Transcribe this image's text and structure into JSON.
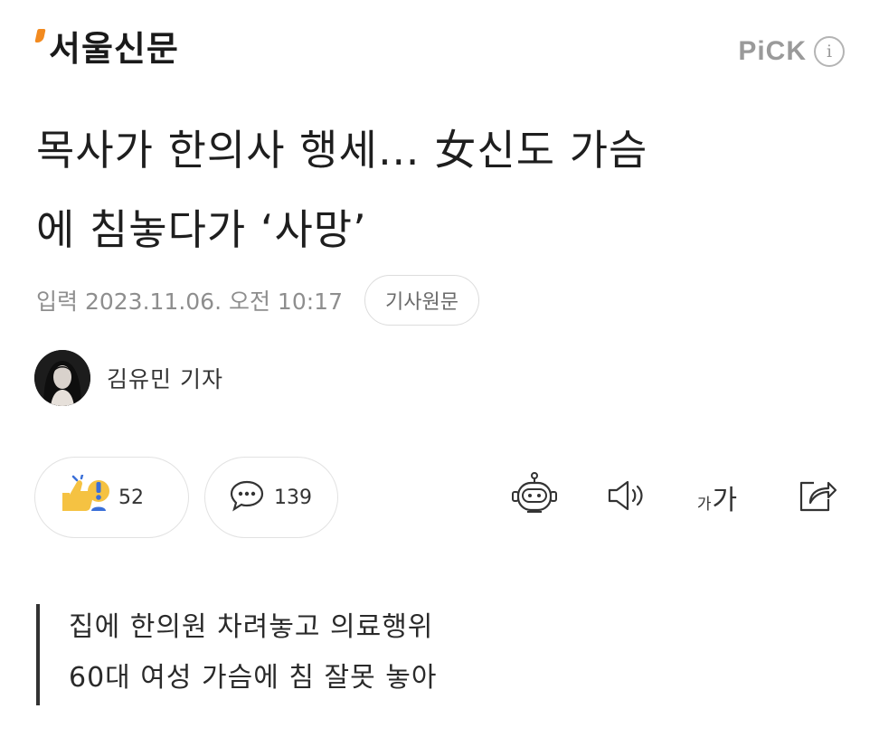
{
  "header": {
    "logo_text": "서울신문",
    "pick_label": "PiCK",
    "info_icon": "info-icon"
  },
  "article": {
    "headline_line1": "목사가 한의사 행세… 女신도 가슴",
    "headline_line2": "에 침놓다가 ‘사망’",
    "date": "입력 2023.11.06. 오전 10:17",
    "source_button": "기사원문",
    "author": "김유민 기자"
  },
  "actions": {
    "reaction_count": "52",
    "comment_count": "139",
    "font_size_small": "가",
    "font_size_large": "가",
    "icons": [
      "reaction-icon",
      "comment-icon",
      "summary-bot-icon",
      "speaker-icon",
      "font-size-icon",
      "share-icon"
    ]
  },
  "summary": {
    "line1": "집에 한의원 차려놓고 의료행위",
    "line2": "60대 여성 가슴에 침 잘못 놓아"
  },
  "colors": {
    "logo_accent": "#f28a1f",
    "pick_gray": "#9a9a9a",
    "reaction_yellow": "#f5c242",
    "reaction_blue": "#3a6fd8"
  }
}
